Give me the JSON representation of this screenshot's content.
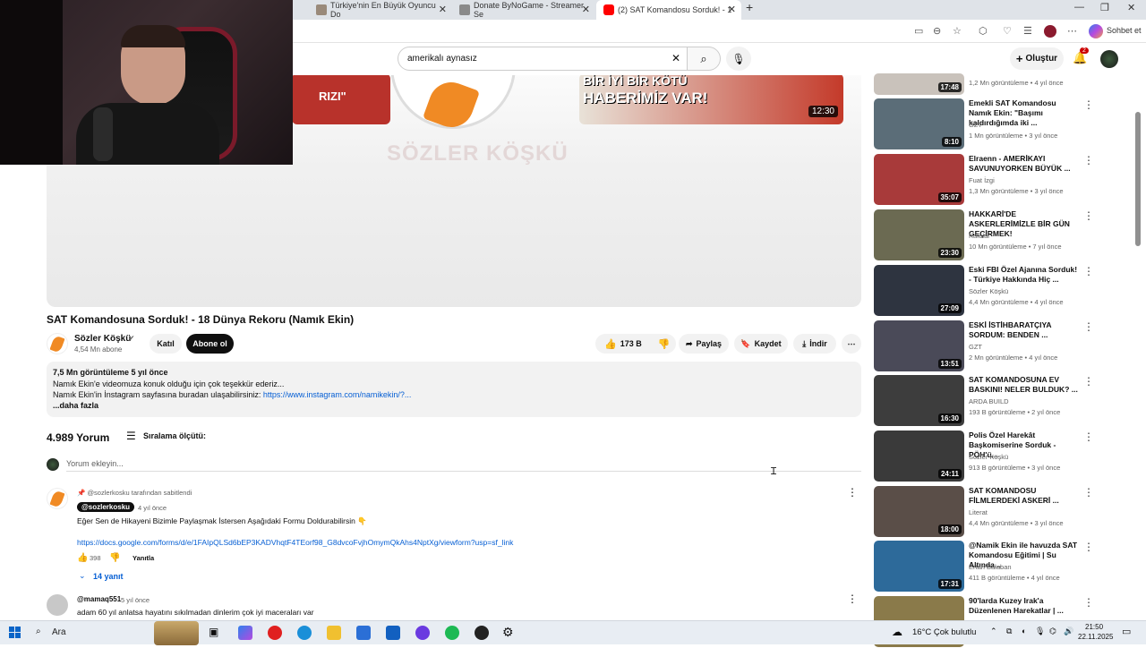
{
  "browser": {
    "tabs": [
      {
        "title": "Türkiye'nin En Büyük Oyuncu Do",
        "color": "#9a8a7a"
      },
      {
        "title": "Donate ByNoGame - Streamer Se",
        "color": "#8a8a8a"
      },
      {
        "title": "(2) SAT Komandosu Sorduk! - 1",
        "color": "#ff0000"
      }
    ],
    "new_tab": "+",
    "chat_button": "Sohbet et"
  },
  "youtube": {
    "search_query": "amerikalı aynasız",
    "create_label": "Oluştur",
    "notification_count": "2"
  },
  "player": {
    "thumb_text_left": "RIZI\"",
    "thumb_text_right_1": "BİR İYİ BİR KÖTÜ",
    "thumb_text_right_2": "HABERİMİZ VAR!",
    "thumb_right_duration": "12:30",
    "watermark": "SÖZLER KÖŞKÜ"
  },
  "video": {
    "title": "SAT Komandosuna Sorduk! - 18 Dünya Rekoru (Namık Ekin)",
    "channel": "Sözler Köşkü",
    "subscribers": "4,54 Mn abone",
    "join": "Katıl",
    "subscribe": "Abone ol",
    "likes": "173 B",
    "share": "Paylaş",
    "save": "Kaydet",
    "download": "İndir"
  },
  "description": {
    "stats": "7,5 Mn görüntüleme  5 yıl önce",
    "line1": "Namık Ekin'e videomuza konuk olduğu için çok teşekkür ederiz...",
    "line2_prefix": "Namık Ekin'in İnstagram sayfasına buradan ulaşabilirsiniz:",
    "line2_link": "https://www.instagram.com/namikekin/?...",
    "more": "...daha fazla"
  },
  "comments": {
    "count": "4.989 Yorum",
    "sort": "Sıralama ölçütü:",
    "add_placeholder": "Yorum ekleyin...",
    "pinned_note": "@sozlerkosku tarafından sabitlendi",
    "items": [
      {
        "author": "@sozlerkosku",
        "time": "4 yıl önce",
        "text": "Eğer Sen de Hikayeni Bizimle Paylaşmak İstersen Aşağıdaki Formu Doldurabilirsin 👇",
        "link": "https://docs.google.com/forms/d/e/1FAIpQLSd6bEP3KADVhqtF4TEorf98_G8dvcoFvjhOmymQkAhs4NptXg/viewform?usp=sf_link",
        "likes": "398",
        "reply": "Yanıtla",
        "replies": "14 yanıt"
      },
      {
        "author": "@mamaq551",
        "time": "5 yıl önce",
        "text": "adam 60 yıl anlatsa hayatını sıkılmadan dinlerim çok iyi maceraları var"
      }
    ]
  },
  "sidebar": [
    {
      "title": "",
      "channel": "",
      "meta": "1,2 Mn görüntüleme • 4 yıl önce",
      "duration": "17:48",
      "color": "#c9c2bb"
    },
    {
      "title": "Emekli SAT Komandosu Namık Ekin: \"Başımı kaldırdığımda iki ...",
      "channel": "GZT",
      "meta": "1 Mn görüntüleme • 3 yıl önce",
      "duration": "8:10",
      "color": "#5b6d78"
    },
    {
      "title": "Elraenn - AMERİKAYI SAVUNUYORKEN BÜYÜK ...",
      "channel": "Fuat İzgi",
      "meta": "1,3 Mn görüntüleme • 3 yıl önce",
      "duration": "35:07",
      "color": "#a83a3a"
    },
    {
      "title": "HAKKARİ'DE ASKERLERİMİZLE BİR GÜN GEÇİRMEK!",
      "channel": "Kafalar",
      "meta": "10 Mn görüntüleme • 7 yıl önce",
      "duration": "23:30",
      "color": "#6b6a52"
    },
    {
      "title": "Eski FBI Özel Ajanına Sorduk! - Türkiye Hakkında Hiç ...",
      "channel": "Sözler Köşkü",
      "meta": "4,4 Mn görüntüleme • 4 yıl önce",
      "duration": "27:09",
      "color": "#2e3440"
    },
    {
      "title": "ESKİ İSTİHBARATÇIYA SORDUM: BENDEN ...",
      "channel": "GZT",
      "meta": "2 Mn görüntüleme • 4 yıl önce",
      "duration": "13:51",
      "color": "#4a4a58"
    },
    {
      "title": "SAT KOMANDOSUNA EV BASKINI! NELER BULDUK? ...",
      "channel": "ARDA BUILD",
      "meta": "193 B görüntüleme • 2 yıl önce",
      "duration": "16:30",
      "color": "#3d3d3d"
    },
    {
      "title": "Polis Özel Harekât Başkomiserine Sorduk - PÖH'ü...",
      "channel": "Sözler Köşkü",
      "meta": "913 B görüntüleme • 3 yıl önce",
      "duration": "24:11",
      "color": "#3a3a3a"
    },
    {
      "title": "SAT KOMANDOSU FİLMLERDEKİ ASKERİ ...",
      "channel": "Literat",
      "meta": "4,4 Mn görüntüleme • 3 yıl önce",
      "duration": "18:00",
      "color": "#5a4e48"
    },
    {
      "title": "@Namik Ekin ile havuzda SAT Komandosu Eğitimi | Su Altında...",
      "channel": "Ertan Balaban",
      "meta": "411 B görüntüleme • 4 yıl önce",
      "duration": "17:31",
      "color": "#2d6a9a"
    },
    {
      "title": "90'larda Kuzey Irak'a Düzenlenen Harekatlar | ...",
      "channel": "",
      "meta": "",
      "duration": "",
      "color": "#8a7a4a"
    }
  ],
  "taskbar": {
    "search": "Ara",
    "weather": "16°C  Çok bulutlu",
    "time": "21:50",
    "date": "22.11.2025"
  }
}
